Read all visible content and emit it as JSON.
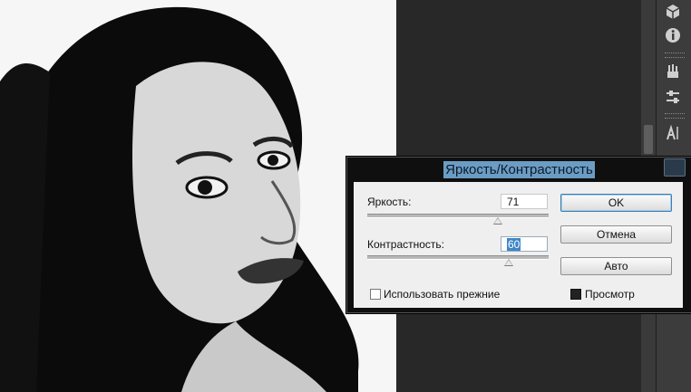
{
  "dialog": {
    "title": "Яркость/Контрастность",
    "brightness": {
      "label": "Яркость:",
      "value": "71",
      "level": 0.72
    },
    "contrast": {
      "label": "Контрастность:",
      "value": "60",
      "level": 0.78
    },
    "buttons": {
      "ok": "OK",
      "cancel": "Отмена",
      "auto": "Авто"
    },
    "use_legacy": {
      "label": "Использовать прежние",
      "checked": false
    },
    "preview": {
      "label": "Просмотр",
      "checked": true
    }
  },
  "panel_tools": [
    "cube-icon",
    "info-icon",
    "brushes-icon",
    "adjust-icon",
    "text-icon"
  ],
  "colors": {
    "title_highlight": "#6b9cc4",
    "dialog_frame": "#0f0f0f",
    "dialog_body": "#efefef"
  }
}
